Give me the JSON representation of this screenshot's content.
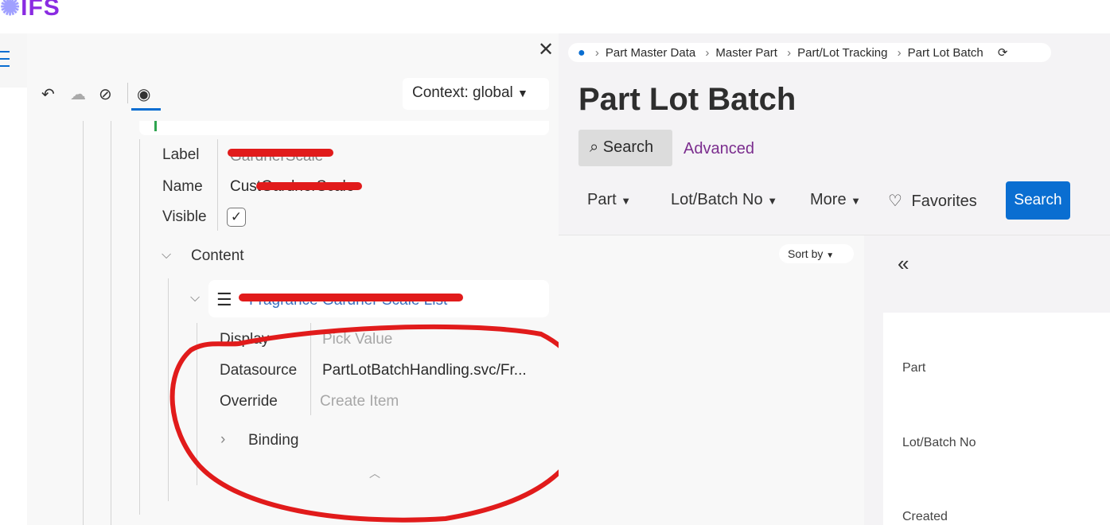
{
  "app": {
    "logo": "IFS"
  },
  "designer": {
    "context_label": "Context: global",
    "toolbar": {
      "undo": "undo-icon",
      "publish": "cloud-upload-icon",
      "hide": "eye-off-icon",
      "preview": "eye-icon"
    },
    "properties": [
      {
        "label": "Label",
        "value": "GardnerScale"
      },
      {
        "label": "Name",
        "value": "CustGardnerScale"
      },
      {
        "label": "Visible",
        "checked": true
      }
    ],
    "content_label": "Content",
    "list_item_title": "Fragrance Gardner Scale List",
    "list_props": [
      {
        "label": "Display",
        "value": "Pick Value",
        "muted": true
      },
      {
        "label": "Datasource",
        "value": "PartLotBatchHandling.svc/Fr..."
      },
      {
        "label": "Override",
        "value": "Create Item",
        "muted": true
      }
    ],
    "binding_label": "Binding"
  },
  "page": {
    "breadcrumb": [
      "Part Master Data",
      "Master Part",
      "Part/Lot Tracking",
      "Part Lot Batch"
    ],
    "title": "Part Lot Batch",
    "search_tab": "Search",
    "advanced_tab": "Advanced",
    "filters": [
      "Part",
      "Lot/Batch No",
      "More"
    ],
    "favorites": "Favorites",
    "search_button": "Search",
    "sort_by": "Sort by",
    "fields": [
      "Part",
      "Lot/Batch No",
      "Created"
    ]
  },
  "colors": {
    "accent": "#0a6ed1",
    "annotation": "#e11b1b",
    "advanced": "#7b2d8e"
  }
}
